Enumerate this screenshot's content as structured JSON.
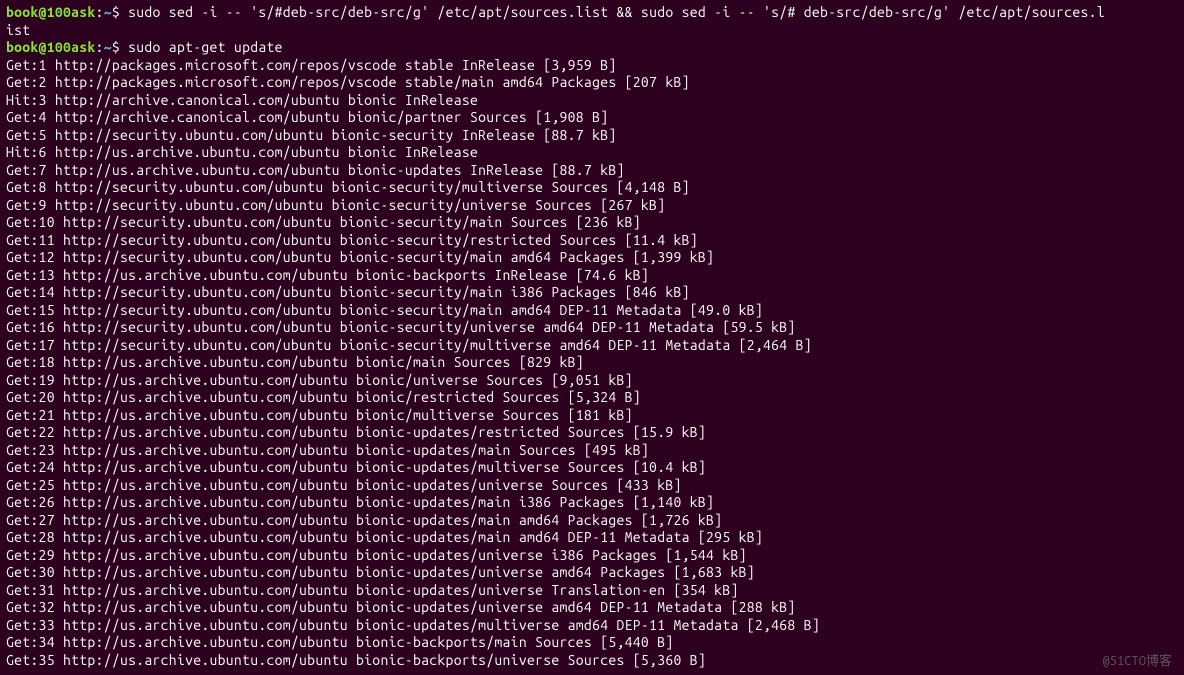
{
  "prompt": {
    "user": "book@100ask",
    "path": "~",
    "separator": ":",
    "dollar": "$"
  },
  "commands": [
    "sudo sed -i -- 's/#deb-src/deb-src/g' /etc/apt/sources.list && sudo sed -i -- 's/# deb-src/deb-src/g' /etc/apt/sources.l",
    "sudo apt-get update"
  ],
  "wrap_line": "ist",
  "output_lines": [
    "Get:1 http://packages.microsoft.com/repos/vscode stable InRelease [3,959 B]",
    "Get:2 http://packages.microsoft.com/repos/vscode stable/main amd64 Packages [207 kB]",
    "Hit:3 http://archive.canonical.com/ubuntu bionic InRelease",
    "Get:4 http://archive.canonical.com/ubuntu bionic/partner Sources [1,908 B]",
    "Get:5 http://security.ubuntu.com/ubuntu bionic-security InRelease [88.7 kB]",
    "Hit:6 http://us.archive.ubuntu.com/ubuntu bionic InRelease",
    "Get:7 http://us.archive.ubuntu.com/ubuntu bionic-updates InRelease [88.7 kB]",
    "Get:8 http://security.ubuntu.com/ubuntu bionic-security/multiverse Sources [4,148 B]",
    "Get:9 http://security.ubuntu.com/ubuntu bionic-security/universe Sources [267 kB]",
    "Get:10 http://security.ubuntu.com/ubuntu bionic-security/main Sources [236 kB]",
    "Get:11 http://security.ubuntu.com/ubuntu bionic-security/restricted Sources [11.4 kB]",
    "Get:12 http://security.ubuntu.com/ubuntu bionic-security/main amd64 Packages [1,399 kB]",
    "Get:13 http://us.archive.ubuntu.com/ubuntu bionic-backports InRelease [74.6 kB]",
    "Get:14 http://security.ubuntu.com/ubuntu bionic-security/main i386 Packages [846 kB]",
    "Get:15 http://security.ubuntu.com/ubuntu bionic-security/main amd64 DEP-11 Metadata [49.0 kB]",
    "Get:16 http://security.ubuntu.com/ubuntu bionic-security/universe amd64 DEP-11 Metadata [59.5 kB]",
    "Get:17 http://security.ubuntu.com/ubuntu bionic-security/multiverse amd64 DEP-11 Metadata [2,464 B]",
    "Get:18 http://us.archive.ubuntu.com/ubuntu bionic/main Sources [829 kB]",
    "Get:19 http://us.archive.ubuntu.com/ubuntu bionic/universe Sources [9,051 kB]",
    "Get:20 http://us.archive.ubuntu.com/ubuntu bionic/restricted Sources [5,324 B]",
    "Get:21 http://us.archive.ubuntu.com/ubuntu bionic/multiverse Sources [181 kB]",
    "Get:22 http://us.archive.ubuntu.com/ubuntu bionic-updates/restricted Sources [15.9 kB]",
    "Get:23 http://us.archive.ubuntu.com/ubuntu bionic-updates/main Sources [495 kB]",
    "Get:24 http://us.archive.ubuntu.com/ubuntu bionic-updates/multiverse Sources [10.4 kB]",
    "Get:25 http://us.archive.ubuntu.com/ubuntu bionic-updates/universe Sources [433 kB]",
    "Get:26 http://us.archive.ubuntu.com/ubuntu bionic-updates/main i386 Packages [1,140 kB]",
    "Get:27 http://us.archive.ubuntu.com/ubuntu bionic-updates/main amd64 Packages [1,726 kB]",
    "Get:28 http://us.archive.ubuntu.com/ubuntu bionic-updates/main amd64 DEP-11 Metadata [295 kB]",
    "Get:29 http://us.archive.ubuntu.com/ubuntu bionic-updates/universe i386 Packages [1,544 kB]",
    "Get:30 http://us.archive.ubuntu.com/ubuntu bionic-updates/universe amd64 Packages [1,683 kB]",
    "Get:31 http://us.archive.ubuntu.com/ubuntu bionic-updates/universe Translation-en [354 kB]",
    "Get:32 http://us.archive.ubuntu.com/ubuntu bionic-updates/universe amd64 DEP-11 Metadata [288 kB]",
    "Get:33 http://us.archive.ubuntu.com/ubuntu bionic-updates/multiverse amd64 DEP-11 Metadata [2,468 B]",
    "Get:34 http://us.archive.ubuntu.com/ubuntu bionic-backports/main Sources [5,440 B]",
    "Get:35 http://us.archive.ubuntu.com/ubuntu bionic-backports/universe Sources [5,360 B]"
  ],
  "watermark": "@51CTO博客"
}
